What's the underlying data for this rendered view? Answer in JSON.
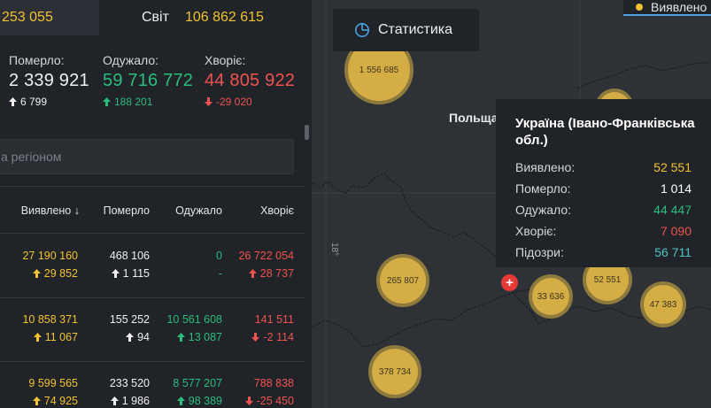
{
  "topbar": {
    "left_value": "253 055",
    "world_label": "Світ",
    "world_value": "106 862 615"
  },
  "summary": {
    "died": {
      "label": "Померло:",
      "value": "2 339 921",
      "delta": "6 799"
    },
    "recovered": {
      "label": "Одужало:",
      "value": "59 716 772",
      "delta": "188 201"
    },
    "sick": {
      "label": "Хворіє:",
      "value": "44 805 922",
      "delta": "-29 020"
    }
  },
  "search": {
    "placeholder": "а регіоном"
  },
  "table": {
    "headers": {
      "detected": "Виявлено",
      "sort_arrow": "↓",
      "died": "Померло",
      "recovered": "Одужало",
      "sick": "Хворіє"
    },
    "rows": [
      {
        "detected": "27 190 160",
        "detected_delta": "29 852",
        "died": "468 106",
        "died_delta": "1 115",
        "recovered": "0",
        "recovered_delta": "-",
        "sick": "26 722 054",
        "sick_delta": "28 737",
        "sick_dir": "up"
      },
      {
        "detected": "10 858 371",
        "detected_delta": "11 067",
        "died": "155 252",
        "died_delta": "94",
        "recovered": "10 561 608",
        "recovered_delta": "13 087",
        "sick": "141 511",
        "sick_delta": "-2 114",
        "sick_dir": "down"
      },
      {
        "detected": "9 599 565",
        "detected_delta": "74 925",
        "died": "233 520",
        "died_delta": "1 986",
        "recovered": "8 577 207",
        "recovered_delta": "98 389",
        "sick": "788 838",
        "sick_delta": "-25 450",
        "sick_dir": "down"
      }
    ]
  },
  "map": {
    "stat_button": "Статистика",
    "legend_label": "Виявлено",
    "country_label": "Польща",
    "meridian_label": "18°",
    "bubbles": [
      {
        "value": "1 556 685"
      },
      {
        "value": "265 807"
      },
      {
        "value": "378 734"
      },
      {
        "value": "33 636"
      },
      {
        "value": "52 551"
      },
      {
        "value": "47 383"
      }
    ],
    "tooltip": {
      "title": "Україна (Івано-Франківська обл.)",
      "rows": [
        {
          "label": "Виявлено:",
          "value": "52 551",
          "color": "#f2c230"
        },
        {
          "label": "Померло:",
          "value": "1 014",
          "color": "#ffffff"
        },
        {
          "label": "Одужало:",
          "value": "44 447",
          "color": "#2bbd7e"
        },
        {
          "label": "Хворіє:",
          "value": "7 090",
          "color": "#ef5350"
        },
        {
          "label": "Підозри:",
          "value": "56 711",
          "color": "#4fc3c3"
        }
      ]
    }
  },
  "colors": {
    "detected": "#f2c230",
    "recovered": "#2bbd7e",
    "sick": "#ef5350",
    "suspected": "#4fc3c3",
    "accent": "#4aa3df"
  }
}
